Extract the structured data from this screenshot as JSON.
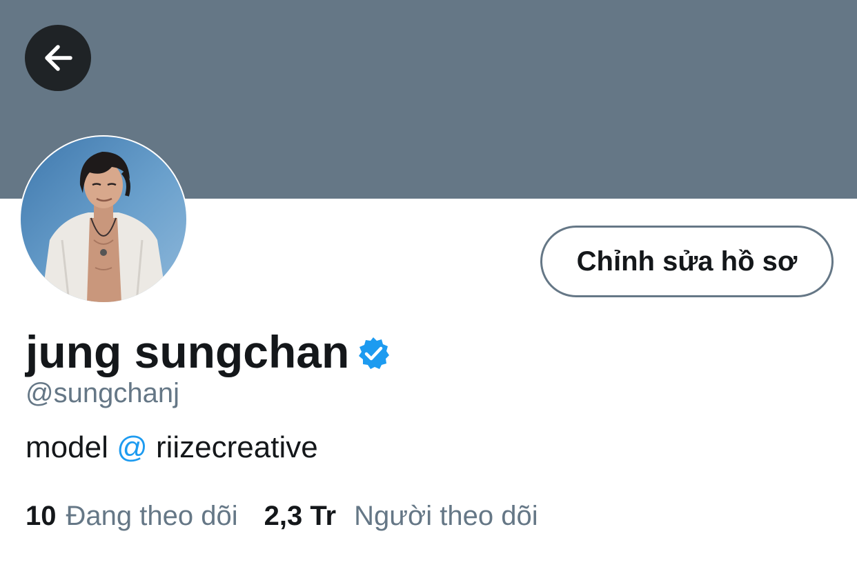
{
  "header": {
    "banner_color": "#657786",
    "back_icon": "arrow-left-icon"
  },
  "profile": {
    "avatar_icon": "profile-avatar",
    "display_name": "jung sungchan",
    "verified_icon": "verified-badge-icon",
    "verified_color": "#1d9bf0",
    "handle": "@sungchanj",
    "bio": {
      "prefix": "model ",
      "at_symbol": "@",
      "mention": " riizecreative"
    }
  },
  "actions": {
    "edit_profile_label": "Chỉnh sửa hồ sơ"
  },
  "stats": {
    "following_count": "10",
    "following_label": "Đang theo dõi",
    "followers_count": "2,3 Tr",
    "followers_label": "Người theo dõi"
  }
}
